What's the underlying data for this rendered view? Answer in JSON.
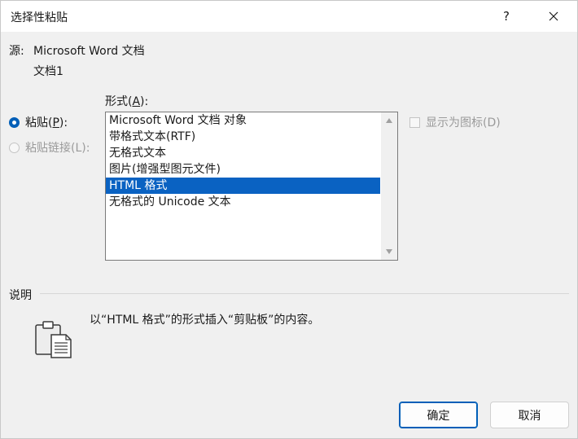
{
  "window": {
    "title": "选择性粘贴",
    "help_label": "?"
  },
  "source": {
    "label": "源:",
    "value": "Microsoft Word 文档",
    "document": "文档1"
  },
  "format": {
    "label_prefix": "形式(",
    "label_key": "A",
    "label_suffix": "):",
    "items": [
      "Microsoft Word 文档 对象",
      "带格式文本(RTF)",
      "无格式文本",
      "图片(增强型图元文件)",
      "HTML 格式",
      "无格式的 Unicode 文本"
    ],
    "selected": "HTML 格式"
  },
  "paste": {
    "prefix": "粘贴(",
    "key": "P",
    "suffix": "):",
    "checked": true
  },
  "paste_link": {
    "label": "粘贴链接(L):",
    "checked": false
  },
  "display_as_icon": {
    "label": "显示为图标(D)",
    "checked": false
  },
  "description": {
    "label": "说明",
    "text": "以“HTML 格式”的形式插入“剪贴板”的内容。",
    "icon": "clipboard-icon"
  },
  "buttons": {
    "ok": "确定",
    "cancel": "取消"
  },
  "colors": {
    "accent": "#005fb8",
    "selection": "#0a62c2",
    "background": "#f0f0f0"
  }
}
